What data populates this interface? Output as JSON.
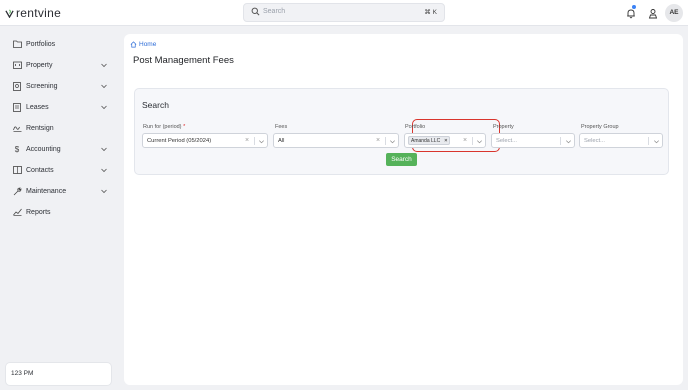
{
  "app": {
    "logo_text": "rentvine",
    "brand_color": "#2b2d33"
  },
  "topbar": {
    "search_placeholder": "Search",
    "search_shortcut": "⌘ K",
    "avatar_initials": "AE",
    "icons": [
      "search-icon",
      "bell-icon",
      "person-icon"
    ]
  },
  "sidebar": {
    "items": [
      {
        "label": "Portfolios",
        "icon": "folder-icon",
        "has_chevron": false
      },
      {
        "label": "Property",
        "icon": "building-icon",
        "has_chevron": true
      },
      {
        "label": "Screening",
        "icon": "screening-icon",
        "has_chevron": true
      },
      {
        "label": "Leases",
        "icon": "lease-icon",
        "has_chevron": true
      },
      {
        "label": "Rentsign",
        "icon": "signature-icon",
        "has_chevron": false
      },
      {
        "label": "Accounting",
        "icon": "dollar-icon",
        "has_chevron": true
      },
      {
        "label": "Contacts",
        "icon": "contacts-icon",
        "has_chevron": true
      },
      {
        "label": "Maintenance",
        "icon": "wrench-icon",
        "has_chevron": true
      },
      {
        "label": "Reports",
        "icon": "reports-icon",
        "has_chevron": false
      }
    ],
    "status": "123 PM"
  },
  "main": {
    "breadcrumb": "Home",
    "title": "Post Management Fees",
    "card_title": "Search",
    "fields": {
      "run_for": {
        "label": "Run for (period)",
        "required_mark": "*",
        "value": "Current Period (05/2024)"
      },
      "fees": {
        "label": "Fees",
        "value": "All"
      },
      "portfolio": {
        "label": "Portfolio",
        "chip": "Amanda LLC",
        "chip_remove": "×"
      },
      "property": {
        "label": "Property",
        "placeholder": "Select..."
      },
      "property_group": {
        "label": "Property Group",
        "placeholder": "Select..."
      }
    },
    "search_button": "Search",
    "colors": {
      "accent_green": "#55b25a",
      "link_blue": "#2f6ed8",
      "highlight_red": "#d9352d"
    }
  }
}
